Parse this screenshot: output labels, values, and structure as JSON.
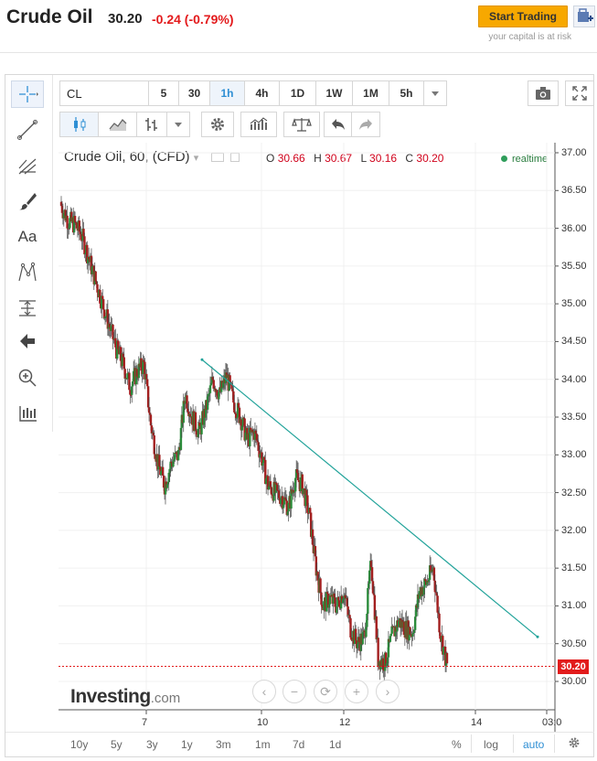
{
  "header": {
    "title": "Crude Oil",
    "price": "30.20",
    "change": "-0.24 (-0.79%)",
    "start_trading": "Start Trading",
    "capital_risk": "your capital is at risk"
  },
  "toolbar": {
    "symbol": "CL",
    "intervals": [
      "5",
      "30",
      "1h",
      "4h",
      "1D",
      "1W",
      "1M",
      "5h"
    ],
    "active_interval": "1h"
  },
  "left_tools": [
    "crosshair-icon",
    "trendline-icon",
    "fib-icon",
    "brush-icon",
    "text-icon",
    "pattern-icon",
    "measure-icon",
    "arrow-left-icon",
    "zoom-icon",
    "indicator-icon"
  ],
  "left_tool_text": "Aa",
  "chart_legend": {
    "label": "Crude Oil, 60, (CFD)",
    "o_label": "O",
    "o": "30.66",
    "h_label": "H",
    "h": "30.67",
    "l_label": "L",
    "l": "30.16",
    "c_label": "C",
    "c": "30.20",
    "realtime": "realtime"
  },
  "colors": {
    "up": "#2b8c3b",
    "down": "#a31f1f",
    "accent": "#2f8fd4",
    "trendline": "#22a39a",
    "price_tag": "#e21c1c"
  },
  "brand": {
    "name": "Investing",
    "suffix": ".com"
  },
  "nav_buttons": [
    "‹",
    "−",
    "⟳",
    "+",
    "›"
  ],
  "chart_data": {
    "type": "candlestick",
    "title": "Crude Oil, 60, (CFD)",
    "ylim": [
      29.8,
      37.05
    ],
    "yticks": [
      "37.00",
      "36.50",
      "36.00",
      "35.50",
      "35.00",
      "34.50",
      "34.00",
      "33.50",
      "33.00",
      "32.50",
      "32.00",
      "31.50",
      "31.00",
      "30.50",
      "30.00"
    ],
    "xticks": [
      "7",
      "10",
      "12",
      "14",
      "03:0"
    ],
    "last_price": "30.20",
    "close_series": [
      36.3,
      36.1,
      36.05,
      35.9,
      35.6,
      35.3,
      35.0,
      34.7,
      34.4,
      34.2,
      33.9,
      34.1,
      34.2,
      33.4,
      32.9,
      32.6,
      32.9,
      33.0,
      33.8,
      33.5,
      33.3,
      33.6,
      34.0,
      33.8,
      34.05,
      33.7,
      33.5,
      33.2,
      33.3,
      33.0,
      32.6,
      32.5,
      32.45,
      32.3,
      32.7,
      32.6,
      32.2,
      31.5,
      31.0,
      31.1,
      31.0,
      31.2,
      30.7,
      30.5,
      30.6,
      31.6,
      30.3,
      30.25,
      30.6,
      30.8,
      30.7,
      30.65,
      31.2,
      31.3,
      31.5,
      30.66,
      30.2
    ],
    "trendline": [
      {
        "x": "8 Mar 12:00",
        "y": 34.26
      },
      {
        "x": "14 Mar 14:00",
        "y": 30.59
      }
    ]
  },
  "bottom_bar": {
    "ranges": [
      "10y",
      "5y",
      "3y",
      "1y",
      "3m",
      "1m",
      "7d",
      "1d"
    ],
    "percent": "%",
    "log": "log",
    "auto": "auto"
  }
}
